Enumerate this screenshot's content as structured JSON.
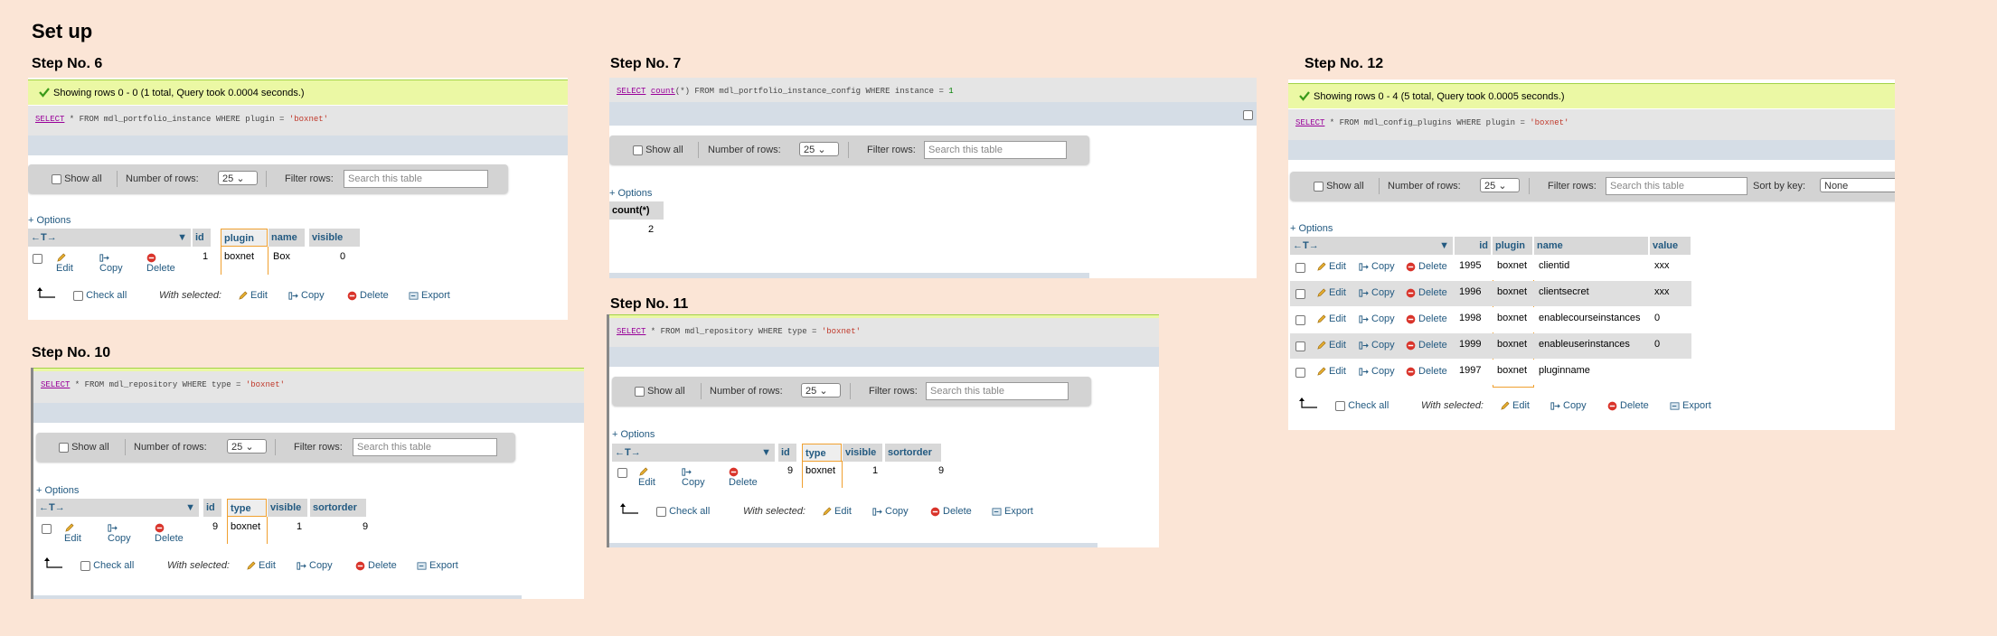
{
  "title": "Set up",
  "common": {
    "show_all": "Show all",
    "number_of_rows": "Number of rows:",
    "rows_value": "25",
    "filter_rows": "Filter rows:",
    "filter_placeholder": "Search this table",
    "options": "+ Options",
    "nav_arrows": "←T→",
    "edit": "Edit",
    "copy": "Copy",
    "delete": "Delete",
    "export": "Export",
    "check_all": "Check all",
    "with_selected": "With selected:"
  },
  "step6": {
    "label": "Step No. 6",
    "success": "Showing rows 0 - 0 (1 total, Query took 0.0004 seconds.)",
    "sql": {
      "kw": "SELECT",
      "mid": " * FROM mdl_portfolio_instance WHERE plugin = ",
      "str": "'boxnet'"
    },
    "columns": [
      "id",
      "plugin",
      "name",
      "visible"
    ],
    "rows": [
      [
        "1",
        "boxnet",
        "Box",
        "0"
      ]
    ]
  },
  "step7": {
    "label": "Step No. 7",
    "sql": {
      "kw": "SELECT",
      "fn": "count",
      "mid": "(*) FROM mdl_portfolio_instance_config WHERE instance = ",
      "num": "1"
    },
    "columns": [
      "count(*)"
    ],
    "rows": [
      [
        "2"
      ]
    ]
  },
  "step10": {
    "label": "Step No. 10",
    "sql": {
      "kw": "SELECT",
      "mid": " * FROM mdl_repository WHERE type = ",
      "str": "'boxnet'"
    },
    "columns": [
      "id",
      "type",
      "visible",
      "sortorder"
    ],
    "rows": [
      [
        "9",
        "boxnet",
        "1",
        "9"
      ]
    ]
  },
  "step11": {
    "label": "Step No. 11",
    "sql": {
      "kw": "SELECT",
      "mid": " * FROM mdl_repository WHERE type = ",
      "str": "'boxnet'"
    },
    "columns": [
      "id",
      "type",
      "visible",
      "sortorder"
    ],
    "rows": [
      [
        "9",
        "boxnet",
        "1",
        "9"
      ]
    ]
  },
  "step12": {
    "label": "Step No. 12",
    "success": "Showing rows 0 - 4 (5 total, Query took 0.0005 seconds.)",
    "sql": {
      "kw": "SELECT",
      "mid": " * FROM mdl_config_plugins WHERE plugin = ",
      "str": "'boxnet'"
    },
    "sort_by_key": "Sort by key:",
    "sort_value": "None",
    "columns": [
      "id",
      "plugin",
      "name",
      "value"
    ],
    "rows": [
      [
        "1995",
        "boxnet",
        "clientid",
        "xxx"
      ],
      [
        "1996",
        "boxnet",
        "clientsecret",
        "xxx"
      ],
      [
        "1998",
        "boxnet",
        "enablecourseinstances",
        "0"
      ],
      [
        "1999",
        "boxnet",
        "enableuserinstances",
        "0"
      ],
      [
        "1997",
        "boxnet",
        "pluginname",
        ""
      ]
    ]
  },
  "colors": {
    "page_bg": "#fbe5d6",
    "success_bg": "#ebf8a4",
    "link": "#235a81",
    "highlight": "#f0a030"
  }
}
